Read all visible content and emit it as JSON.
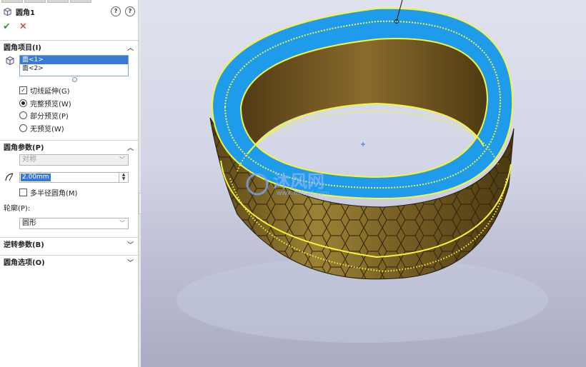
{
  "panel": {
    "title": "圆角1",
    "help_label": "?",
    "info_label": "?",
    "ok_icon": "checkmark-icon",
    "cancel_icon": "cross-icon",
    "sections": {
      "fillet_items": "圆角项目(I)",
      "fillet_params": "圆角参数(P)",
      "reverse_params": "逆转参数(B)",
      "fillet_options": "圆角选项(O)"
    },
    "faces": [
      "面<1>",
      "面<2>"
    ],
    "tangent_propagation": {
      "label": "切线延伸(G)",
      "checked": true
    },
    "preview": {
      "full": "完整预览(W)",
      "partial": "部分预览(P)",
      "none": "无预览(W)",
      "selected": "full"
    },
    "symmetric": "对称",
    "radius": "2.00mm",
    "multi_radius": {
      "label": "多半径圆角(M)",
      "checked": false
    },
    "profile_label": "轮廓(P):",
    "profile_value": "圆形"
  },
  "watermark": {
    "brand": "沐风网",
    "url": "www.mfcad.com"
  },
  "colors": {
    "ring_inner": "#6b5020",
    "ring_outer": "#8e7430",
    "selection_blue": "#1e9bea",
    "highlight_yellow": "#f5f53a",
    "accent_green": "#2e9e2e",
    "accent_red": "#d22222"
  }
}
